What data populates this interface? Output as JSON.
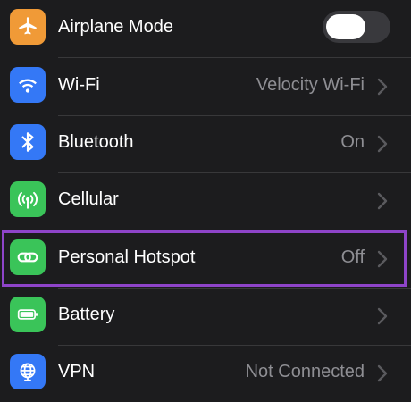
{
  "settings": {
    "rows": [
      {
        "id": "airplane",
        "label": "Airplane Mode",
        "value": "",
        "icon": "airplane-icon",
        "color": "#f09a37",
        "control": "toggle",
        "toggle_on": false
      },
      {
        "id": "wifi",
        "label": "Wi-Fi",
        "value": "Velocity Wi-Fi",
        "icon": "wifi-icon",
        "color": "#3478f6",
        "control": "chevron"
      },
      {
        "id": "bluetooth",
        "label": "Bluetooth",
        "value": "On",
        "icon": "bluetooth-icon",
        "color": "#3478f6",
        "control": "chevron"
      },
      {
        "id": "cellular",
        "label": "Cellular",
        "value": "",
        "icon": "antenna-icon",
        "color": "#3ac459",
        "control": "chevron"
      },
      {
        "id": "hotspot",
        "label": "Personal Hotspot",
        "value": "Off",
        "icon": "hotspot-link-icon",
        "color": "#3ac459",
        "control": "chevron",
        "highlighted": true
      },
      {
        "id": "battery",
        "label": "Battery",
        "value": "",
        "icon": "battery-icon",
        "color": "#3ac459",
        "control": "chevron"
      },
      {
        "id": "vpn",
        "label": "VPN",
        "value": "Not Connected",
        "icon": "globe-icon",
        "color": "#3478f6",
        "control": "chevron"
      }
    ]
  },
  "highlight_color": "#8e44c9"
}
